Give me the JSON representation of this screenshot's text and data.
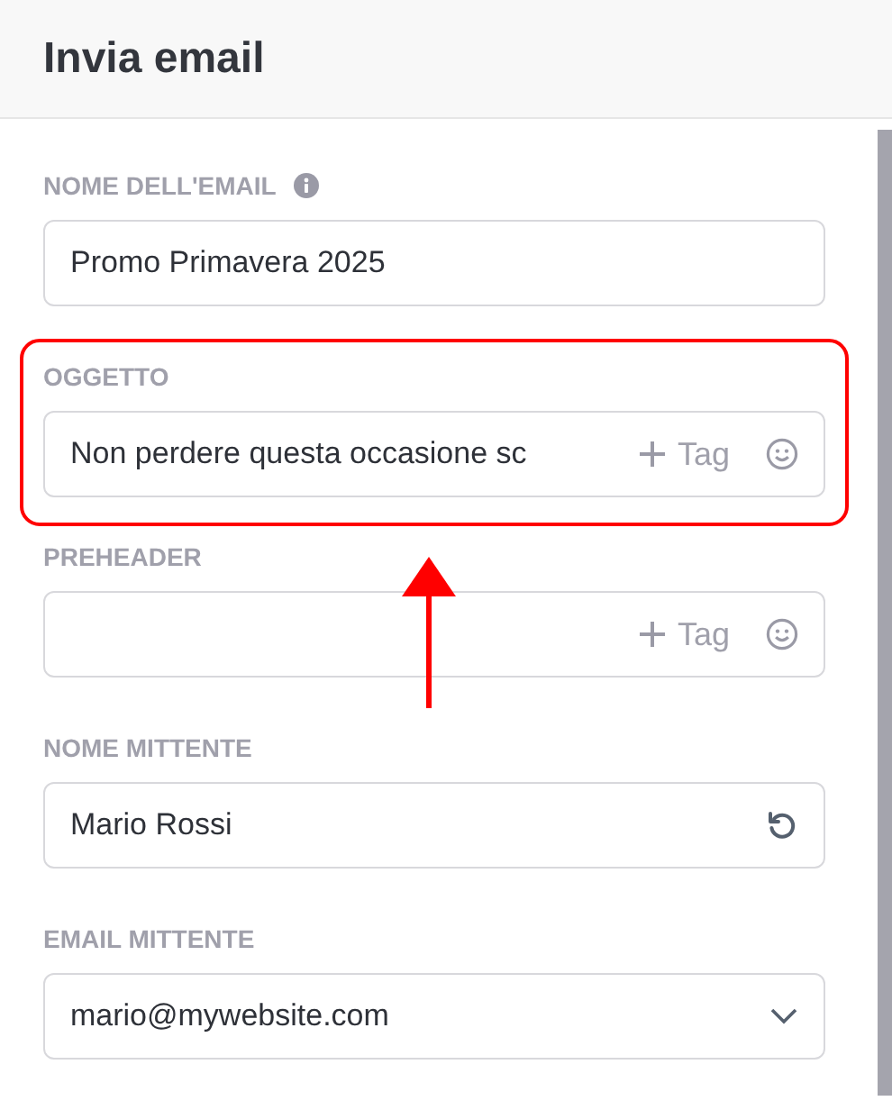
{
  "header": {
    "title": "Invia email"
  },
  "fields": [
    {
      "kind": "text",
      "label": "NOME DELL'EMAIL",
      "info": true,
      "value": "Promo Primavera 2025",
      "highlighted": false
    },
    {
      "kind": "tags",
      "label": "OGGETTO",
      "info": false,
      "value": "Non perdere questa occasione sc",
      "tag_button": "Tag",
      "highlighted": true
    },
    {
      "kind": "tags",
      "label": "PREHEADER",
      "info": false,
      "tag_button": "Tag",
      "highlighted": false
    },
    {
      "kind": "reset",
      "label": "NOME MITTENTE",
      "info": false,
      "value": "Mario Rossi",
      "highlighted": false
    },
    {
      "kind": "select",
      "label": "EMAIL MITTENTE",
      "info": false,
      "value": "mario@mywebsite.com",
      "highlighted": false
    }
  ]
}
